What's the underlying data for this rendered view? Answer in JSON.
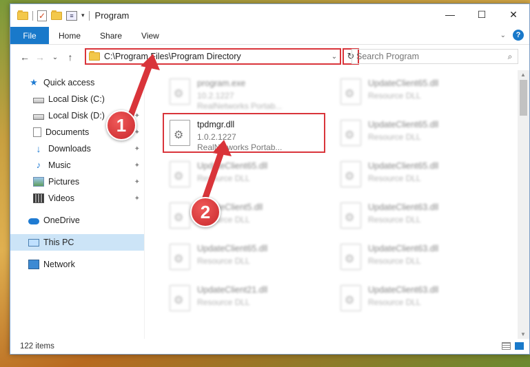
{
  "window": {
    "title": "Program",
    "controls": {
      "minimize": "—",
      "maximize": "☐",
      "close": "✕"
    }
  },
  "ribbon": {
    "tabs": [
      "File",
      "Home",
      "Share",
      "View"
    ],
    "help_glyph": "?",
    "collapse_glyph": "⌄"
  },
  "nav": {
    "back": "←",
    "forward": "→",
    "recent": "⌄",
    "up": "↑",
    "address": "C:\\Program Files\\Program Directory",
    "address_dropdown": "⌄",
    "refresh": "↻",
    "search_placeholder": "Search Program",
    "search_icon": "⌕"
  },
  "sidebar": {
    "items": [
      {
        "label": "Quick access",
        "icon": "star-icon",
        "pinned": false
      },
      {
        "label": "Local Disk (C:)",
        "icon": "disk-icon",
        "pinned": true
      },
      {
        "label": "Local Disk (D:)",
        "icon": "disk-icon",
        "pinned": true
      },
      {
        "label": "Documents",
        "icon": "document-icon",
        "pinned": true
      },
      {
        "label": "Downloads",
        "icon": "download-icon",
        "pinned": true
      },
      {
        "label": "Music",
        "icon": "music-icon",
        "pinned": true
      },
      {
        "label": "Pictures",
        "icon": "pictures-icon",
        "pinned": true
      },
      {
        "label": "Videos",
        "icon": "videos-icon",
        "pinned": true
      },
      {
        "label": "OneDrive",
        "icon": "cloud-icon",
        "pinned": false
      },
      {
        "label": "This PC",
        "icon": "computer-icon",
        "pinned": false,
        "selected": true
      },
      {
        "label": "Network",
        "icon": "network-icon",
        "pinned": false
      }
    ],
    "pin_glyph": "📌"
  },
  "files": {
    "col1": [
      {
        "name": "program.exe",
        "version": "10.2.1227",
        "desc": "RealNetworks Portab..."
      },
      {
        "name": "tpdmgr.dll",
        "version": "1.0.2.1227",
        "desc": "RealNetworks Portab..."
      },
      {
        "name": "UpdateClient65.dll",
        "version": "",
        "desc": "Resource DLL"
      },
      {
        "name": "UpdateClient5.dll",
        "version": "",
        "desc": "Resource DLL"
      },
      {
        "name": "UpdateClient65.dll",
        "version": "",
        "desc": "Resource DLL"
      },
      {
        "name": "UpdateClient21.dll",
        "version": "",
        "desc": "Resource DLL"
      }
    ],
    "col2": [
      {
        "name": "UpdateClient65.dll",
        "version": "",
        "desc": "Resource DLL"
      },
      {
        "name": "UpdateClient65.dll",
        "version": "",
        "desc": "Resource DLL"
      },
      {
        "name": "UpdateClient65.dll",
        "version": "",
        "desc": "Resource DLL"
      },
      {
        "name": "UpdateClient63.dll",
        "version": "",
        "desc": "Resource DLL"
      },
      {
        "name": "UpdateClient63.dll",
        "version": "",
        "desc": "Resource DLL"
      },
      {
        "name": "UpdateClient63.dll",
        "version": "",
        "desc": "Resource DLL"
      }
    ]
  },
  "status": {
    "item_count": "122 items"
  },
  "annotations": {
    "step1": "1",
    "step2": "2",
    "accent": "#d9343a"
  }
}
